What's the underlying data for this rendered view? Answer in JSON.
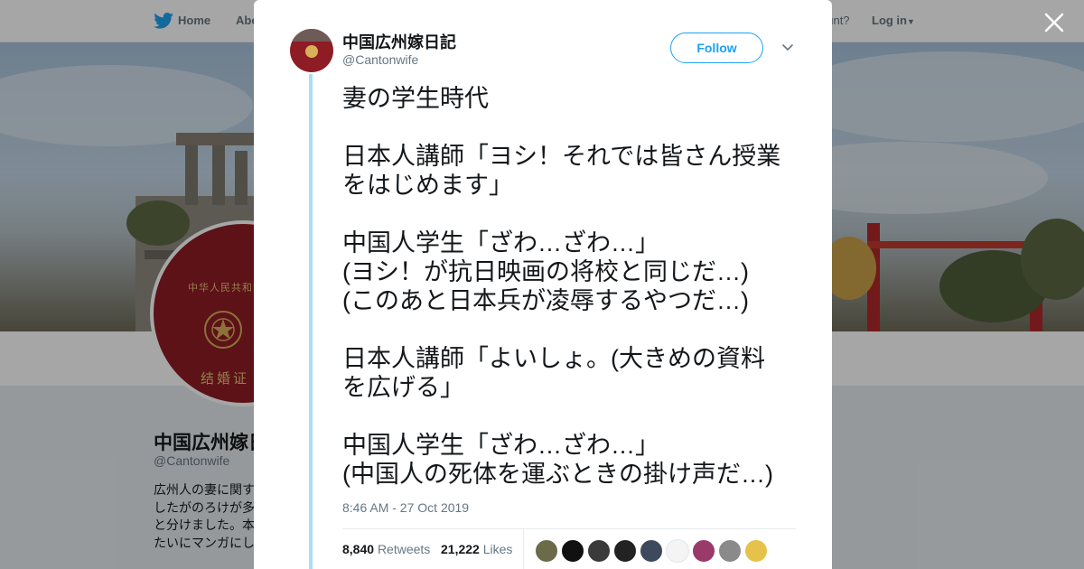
{
  "topnav": {
    "home_label": "Home",
    "about_label": "Abo",
    "account_prompt": "ccount?",
    "login_label": "Log in"
  },
  "profile": {
    "name": "中国広州嫁日",
    "handle": "@Cantonwife",
    "bio_lines": [
      "広州人の妻に関す",
      "したがのろけが多",
      "と分けました。本",
      "たいにマンガにし"
    ],
    "passport_title": "中华人民共和国",
    "passport_bottom": "结婚证"
  },
  "tweet": {
    "author_name": "中国広州嫁日記",
    "author_handle": "@Cantonwife",
    "follow_label": "Follow",
    "paragraphs": [
      [
        "妻の学生時代"
      ],
      [
        "日本人講師「ヨシ！それでは皆さん授業",
        "をはじめます」"
      ],
      [
        "中国人学生「ざわ…ざわ…」",
        "(ヨシ！が抗日映画の将校と同じだ…)",
        "(このあと日本兵が凌辱するやつだ…)"
      ],
      [
        "日本人講師「よいしょ。(大きめの資料",
        "を広げる」"
      ],
      [
        "中国人学生「ざわ…ざわ…」",
        "(中国人の死体を運ぶときの掛け声だ…)"
      ]
    ],
    "timestamp": "8:46 AM - 27 Oct 2019",
    "retweets": {
      "count": "8,840",
      "label": "Retweets"
    },
    "likes": {
      "count": "21,222",
      "label": "Likes"
    },
    "liker_avatar_colors": [
      "#6b6b4a",
      "#111111",
      "#3a3a3a",
      "#222222",
      "#3d4a5c",
      "#f4f4f4",
      "#9a3a6a",
      "#8a8a8a",
      "#e7c24a"
    ]
  },
  "colors": {
    "accent": "#1da1f2",
    "thread_line": "#abdcf9",
    "text": "#14171a",
    "muted": "#657786"
  }
}
